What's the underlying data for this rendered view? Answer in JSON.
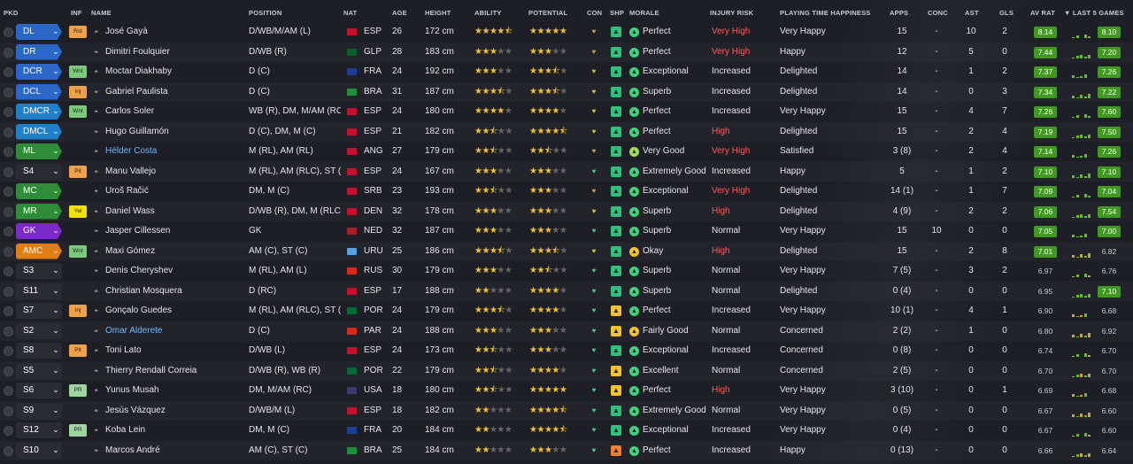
{
  "headers": {
    "pkd": "PKD",
    "inf": "INF",
    "name": "NAME",
    "position": "POSITION",
    "nat": "NAT",
    "age": "AGE",
    "height": "HEIGHT",
    "ability": "ABILITY",
    "potential": "POTENTIAL",
    "con": "CON",
    "shp": "SHP",
    "morale": "MORALE",
    "injury": "INJURY RISK",
    "happiness": "PLAYING TIME HAPPINESS",
    "apps": "APPS",
    "conc": "CONC",
    "ast": "AST",
    "gls": "GLS",
    "avrat": "AV RAT",
    "last5": "▼ LAST 5 GAMES"
  },
  "colors": {
    "gk": "#7b2ac7",
    "def": "#2b67c9",
    "dm": "#1f7fc9",
    "mid": "#2f8d3a",
    "att": "#e07e15",
    "inj_high": "#ff5a5a",
    "rating_green": "#3f9a1f"
  },
  "players": [
    {
      "pos": "DL",
      "posColor": "#2b67c9",
      "inf": "Rst",
      "infColor": "#f0a048",
      "name": "José Gayà",
      "position": "D/WB/M/AM (L)",
      "flag": "#c8102e",
      "nat": "ESP",
      "age": "26",
      "height": "172 cm",
      "ability": 4.5,
      "potential": 5,
      "conColor": "#c9a24b",
      "shpColor": "#2fc07a",
      "morale": "Perfect",
      "moraleColor": "#3ed27a",
      "injury": "Very High",
      "injRed": true,
      "happiness": "Very Happy",
      "apps": "15",
      "conc": "-",
      "ast": "10",
      "gls": "2",
      "avr": "8.14",
      "avrColor": "#3f9a1f",
      "l5": "8.10",
      "l5Color": "#3f9a1f"
    },
    {
      "pos": "DR",
      "posColor": "#2b67c9",
      "inf": "",
      "infColor": "",
      "name": "Dimitri Foulquier",
      "position": "D/WB (R)",
      "flag": "#0b5d2a",
      "nat": "GLP",
      "age": "28",
      "height": "183 cm",
      "ability": 3,
      "potential": 3,
      "conColor": "#c9a24b",
      "shpColor": "#2fc07a",
      "morale": "Perfect",
      "moraleColor": "#3ed27a",
      "injury": "Very High",
      "injRed": true,
      "happiness": "Happy",
      "apps": "12",
      "conc": "-",
      "ast": "5",
      "gls": "0",
      "avr": "7.44",
      "avrColor": "#3f9a1f",
      "l5": "7.20",
      "l5Color": "#3f9a1f"
    },
    {
      "pos": "DCR",
      "posColor": "#2b67c9",
      "inf": "Wnt",
      "infColor": "#7ec87e",
      "name": "Moctar Diakhaby",
      "position": "D (C)",
      "flag": "#1c3f94",
      "nat": "FRA",
      "age": "24",
      "height": "192 cm",
      "ability": 3,
      "potential": 3.5,
      "conColor": "#d7c03a",
      "shpColor": "#2fc07a",
      "morale": "Exceptional",
      "moraleColor": "#3ed27a",
      "injury": "Increased",
      "injRed": false,
      "happiness": "Delighted",
      "apps": "14",
      "conc": "-",
      "ast": "1",
      "gls": "2",
      "avr": "7.37",
      "avrColor": "#3f9a1f",
      "l5": "7.26",
      "l5Color": "#3f9a1f"
    },
    {
      "pos": "DCL",
      "posColor": "#2b67c9",
      "inf": "Inj",
      "infColor": "#f0a048",
      "name": "Gabriel Paulista",
      "position": "D (C)",
      "flag": "#1f8f3a",
      "nat": "BRA",
      "age": "31",
      "height": "187 cm",
      "ability": 3.5,
      "potential": 3.5,
      "conColor": "#d7c03a",
      "shpColor": "#2fc07a",
      "morale": "Superb",
      "moraleColor": "#3ed27a",
      "injury": "Increased",
      "injRed": false,
      "happiness": "Delighted",
      "apps": "14",
      "conc": "-",
      "ast": "0",
      "gls": "3",
      "avr": "7.34",
      "avrColor": "#3f9a1f",
      "l5": "7.22",
      "l5Color": "#3f9a1f"
    },
    {
      "pos": "DMCR",
      "posColor": "#1f7fc9",
      "inf": "Wnt",
      "infColor": "#7ec87e",
      "name": "Carlos Soler",
      "position": "WB (R), DM, M/AM (RC)",
      "flag": "#c8102e",
      "nat": "ESP",
      "age": "24",
      "height": "180 cm",
      "ability": 4,
      "potential": 4,
      "conColor": "#d7c03a",
      "shpColor": "#2fc07a",
      "morale": "Perfect",
      "moraleColor": "#3ed27a",
      "injury": "Increased",
      "injRed": false,
      "happiness": "Very Happy",
      "apps": "15",
      "conc": "-",
      "ast": "4",
      "gls": "7",
      "avr": "7.26",
      "avrColor": "#3f9a1f",
      "l5": "7.60",
      "l5Color": "#3f9a1f"
    },
    {
      "pos": "DMCL",
      "posColor": "#1f7fc9",
      "inf": "",
      "infColor": "",
      "name": "Hugo Guillamón",
      "position": "D (C), DM, M (C)",
      "flag": "#c8102e",
      "nat": "ESP",
      "age": "21",
      "height": "182 cm",
      "ability": 2.5,
      "potential": 4.5,
      "conColor": "#d7c03a",
      "shpColor": "#2fc07a",
      "morale": "Perfect",
      "moraleColor": "#3ed27a",
      "injury": "High",
      "injRed": true,
      "happiness": "Delighted",
      "apps": "15",
      "conc": "-",
      "ast": "2",
      "gls": "4",
      "avr": "7.19",
      "avrColor": "#3f9a1f",
      "l5": "7.50",
      "l5Color": "#3f9a1f"
    },
    {
      "pos": "ML",
      "posColor": "#2f8d3a",
      "inf": "",
      "infColor": "",
      "name": "Hélder Costa",
      "nameLink": true,
      "position": "M (RL), AM (RL)",
      "flag": "#c8102e",
      "nat": "ANG",
      "age": "27",
      "height": "179 cm",
      "ability": 2.5,
      "potential": 2.5,
      "conColor": "#c9a24b",
      "shpColor": "#2fc07a",
      "morale": "Very Good",
      "moraleColor": "#9fe04a",
      "injury": "Very High",
      "injRed": true,
      "happiness": "Satisfied",
      "apps": "3 (8)",
      "conc": "-",
      "ast": "2",
      "gls": "4",
      "avr": "7.14",
      "avrColor": "#3f9a1f",
      "l5": "7.26",
      "l5Color": "#3f9a1f"
    },
    {
      "pos": "S4",
      "posColor": "",
      "inf": "Pit",
      "infColor": "#f0a048",
      "name": "Manu Vallejo",
      "position": "M (RL), AM (RLC), ST (C)",
      "flag": "#c8102e",
      "nat": "ESP",
      "age": "24",
      "height": "167 cm",
      "ability": 3,
      "potential": 3,
      "conColor": "#3ed27a",
      "shpColor": "#2fc07a",
      "morale": "Extremely Good",
      "moraleColor": "#3ed27a",
      "injury": "Increased",
      "injRed": false,
      "happiness": "Happy",
      "apps": "5",
      "conc": "-",
      "ast": "1",
      "gls": "2",
      "avr": "7.10",
      "avrColor": "#3f9a1f",
      "l5": "7.10",
      "l5Color": "#3f9a1f"
    },
    {
      "pos": "MC",
      "posColor": "#2f8d3a",
      "inf": "",
      "infColor": "",
      "name": "Uroš Račić",
      "position": "DM, M (C)",
      "flag": "#c8102e",
      "nat": "SRB",
      "age": "23",
      "height": "193 cm",
      "ability": 2.5,
      "potential": 3,
      "conColor": "#c9a24b",
      "shpColor": "#2fc07a",
      "morale": "Exceptional",
      "moraleColor": "#3ed27a",
      "injury": "Very High",
      "injRed": true,
      "happiness": "Delighted",
      "apps": "14 (1)",
      "conc": "-",
      "ast": "1",
      "gls": "7",
      "avr": "7.09",
      "avrColor": "#3f9a1f",
      "l5": "7.04",
      "l5Color": "#3f9a1f"
    },
    {
      "pos": "MR",
      "posColor": "#2f8d3a",
      "inf": "Yel",
      "infColor": "#f2e20a",
      "name": "Daniel Wass",
      "position": "D/WB (R), DM, M (RLC)",
      "flag": "#c8102e",
      "nat": "DEN",
      "age": "32",
      "height": "178 cm",
      "ability": 3,
      "potential": 3,
      "conColor": "#d7c03a",
      "shpColor": "#2fc07a",
      "morale": "Superb",
      "moraleColor": "#3ed27a",
      "injury": "High",
      "injRed": true,
      "happiness": "Delighted",
      "apps": "4 (9)",
      "conc": "-",
      "ast": "2",
      "gls": "2",
      "avr": "7.06",
      "avrColor": "#3f9a1f",
      "l5": "7.54",
      "l5Color": "#3f9a1f"
    },
    {
      "pos": "GK",
      "posColor": "#7b2ac7",
      "inf": "",
      "infColor": "",
      "name": "Jasper Cillessen",
      "position": "GK",
      "flag": "#ae1c28",
      "nat": "NED",
      "age": "32",
      "height": "187 cm",
      "ability": 3,
      "potential": 3,
      "conColor": "#3ed27a",
      "shpColor": "#2fc07a",
      "morale": "Superb",
      "moraleColor": "#3ed27a",
      "injury": "Normal",
      "injRed": false,
      "happiness": "Very Happy",
      "apps": "15",
      "conc": "10",
      "ast": "0",
      "gls": "0",
      "avr": "7.05",
      "avrColor": "#3f9a1f",
      "l5": "7.00",
      "l5Color": "#3f9a1f"
    },
    {
      "pos": "AMC",
      "posColor": "#e07e15",
      "inf": "Wnt",
      "infColor": "#7ec87e",
      "name": "Maxi Gómez",
      "position": "AM (C), ST (C)",
      "flag": "#5aa0de",
      "nat": "URU",
      "age": "25",
      "height": "186 cm",
      "ability": 3.5,
      "potential": 3.5,
      "conColor": "#d7c03a",
      "shpColor": "#2fc07a",
      "morale": "Okay",
      "moraleColor": "#f2c230",
      "injury": "High",
      "injRed": true,
      "happiness": "Delighted",
      "apps": "15",
      "conc": "-",
      "ast": "2",
      "gls": "8",
      "avr": "7.01",
      "avrColor": "#3f9a1f",
      "l5": "6.82",
      "l5Color": ""
    },
    {
      "pos": "S3",
      "posColor": "",
      "inf": "",
      "infColor": "",
      "name": "Denis Cheryshev",
      "position": "M (RL), AM (L)",
      "flag": "#d52b1e",
      "nat": "RUS",
      "age": "30",
      "height": "179 cm",
      "ability": 3,
      "potential": 2.5,
      "conColor": "#3ed27a",
      "shpColor": "#2fc07a",
      "morale": "Superb",
      "moraleColor": "#3ed27a",
      "injury": "Normal",
      "injRed": false,
      "happiness": "Very Happy",
      "apps": "7 (5)",
      "conc": "-",
      "ast": "3",
      "gls": "2",
      "avr": "6.97",
      "avrColor": "",
      "l5": "6.76",
      "l5Color": ""
    },
    {
      "pos": "S11",
      "posColor": "",
      "inf": "",
      "infColor": "",
      "name": "Christian Mosquera",
      "position": "D (RC)",
      "flag": "#c8102e",
      "nat": "ESP",
      "age": "17",
      "height": "188 cm",
      "ability": 2,
      "potential": 4,
      "conColor": "#3ed27a",
      "shpColor": "#2fc07a",
      "morale": "Superb",
      "moraleColor": "#3ed27a",
      "injury": "Normal",
      "injRed": false,
      "happiness": "Delighted",
      "apps": "0 (4)",
      "conc": "-",
      "ast": "0",
      "gls": "0",
      "avr": "6.95",
      "avrColor": "",
      "l5": "7.10",
      "l5Color": "#3f9a1f"
    },
    {
      "pos": "S7",
      "posColor": "",
      "inf": "Inj",
      "infColor": "#f0a048",
      "name": "Gonçalo Guedes",
      "position": "M (RL), AM (RLC), ST (C)",
      "flag": "#046a38",
      "nat": "POR",
      "age": "24",
      "height": "179 cm",
      "ability": 3.5,
      "potential": 4,
      "conColor": "#3ed27a",
      "shpColor": "#f2c230",
      "morale": "Perfect",
      "moraleColor": "#3ed27a",
      "injury": "Increased",
      "injRed": false,
      "happiness": "Very Happy",
      "apps": "10 (1)",
      "conc": "-",
      "ast": "4",
      "gls": "1",
      "avr": "6.90",
      "avrColor": "",
      "l5": "6.68",
      "l5Color": ""
    },
    {
      "pos": "S2",
      "posColor": "",
      "inf": "",
      "infColor": "",
      "name": "Omar Alderete",
      "nameLink": true,
      "position": "D (C)",
      "flag": "#d52b1e",
      "nat": "PAR",
      "age": "24",
      "height": "188 cm",
      "ability": 3,
      "potential": 3,
      "conColor": "#3ed27a",
      "shpColor": "#f2c230",
      "morale": "Fairly Good",
      "moraleColor": "#f2c230",
      "injury": "Normal",
      "injRed": false,
      "happiness": "Concerned",
      "apps": "2 (2)",
      "conc": "-",
      "ast": "1",
      "gls": "0",
      "avr": "6.80",
      "avrColor": "",
      "l5": "6.92",
      "l5Color": ""
    },
    {
      "pos": "S8",
      "posColor": "",
      "inf": "Pit",
      "infColor": "#f0a048",
      "name": "Toni Lato",
      "position": "D/WB (L)",
      "flag": "#c8102e",
      "nat": "ESP",
      "age": "24",
      "height": "173 cm",
      "ability": 2.5,
      "potential": 3,
      "conColor": "#3ed27a",
      "shpColor": "#2fc07a",
      "morale": "Exceptional",
      "moraleColor": "#3ed27a",
      "injury": "Increased",
      "injRed": false,
      "happiness": "Concerned",
      "apps": "0 (8)",
      "conc": "-",
      "ast": "0",
      "gls": "0",
      "avr": "6.74",
      "avrColor": "",
      "l5": "6.70",
      "l5Color": ""
    },
    {
      "pos": "S5",
      "posColor": "",
      "inf": "",
      "infColor": "",
      "name": "Thierry Rendall Correia",
      "position": "D/WB (R), WB (R)",
      "flag": "#046a38",
      "nat": "POR",
      "age": "22",
      "height": "179 cm",
      "ability": 2.5,
      "potential": 4,
      "conColor": "#3ed27a",
      "shpColor": "#f2c230",
      "morale": "Excellent",
      "moraleColor": "#3ed27a",
      "injury": "Normal",
      "injRed": false,
      "happiness": "Concerned",
      "apps": "2 (5)",
      "conc": "-",
      "ast": "0",
      "gls": "0",
      "avr": "6.70",
      "avrColor": "",
      "l5": "6.70",
      "l5Color": ""
    },
    {
      "pos": "S6",
      "posColor": "",
      "inf": "PR",
      "infColor": "#9ed49e",
      "name": "Yunus Musah",
      "position": "DM, M/AM (RC)",
      "flag": "#3c3b6e",
      "nat": "USA",
      "age": "18",
      "height": "180 cm",
      "ability": 2.5,
      "potential": 5,
      "conColor": "#3ed27a",
      "shpColor": "#f2c230",
      "morale": "Perfect",
      "moraleColor": "#3ed27a",
      "injury": "High",
      "injRed": true,
      "happiness": "Very Happy",
      "apps": "3 (10)",
      "conc": "-",
      "ast": "0",
      "gls": "1",
      "avr": "6.69",
      "avrColor": "",
      "l5": "6.68",
      "l5Color": ""
    },
    {
      "pos": "S9",
      "posColor": "",
      "inf": "",
      "infColor": "",
      "name": "Jesús Vázquez",
      "position": "D/WB/M (L)",
      "flag": "#c8102e",
      "nat": "ESP",
      "age": "18",
      "height": "182 cm",
      "ability": 2,
      "potential": 4.5,
      "conColor": "#3ed27a",
      "shpColor": "#2fc07a",
      "morale": "Extremely Good",
      "moraleColor": "#3ed27a",
      "injury": "Normal",
      "injRed": false,
      "happiness": "Very Happy",
      "apps": "0 (5)",
      "conc": "-",
      "ast": "0",
      "gls": "0",
      "avr": "6.67",
      "avrColor": "",
      "l5": "6.60",
      "l5Color": ""
    },
    {
      "pos": "S12",
      "posColor": "",
      "inf": "PR",
      "infColor": "#9ed49e",
      "name": "Koba Lein",
      "position": "DM, M (C)",
      "flag": "#1c3f94",
      "nat": "FRA",
      "age": "20",
      "height": "184 cm",
      "ability": 2,
      "potential": 4.5,
      "conColor": "#3ed27a",
      "shpColor": "#2fc07a",
      "morale": "Exceptional",
      "moraleColor": "#3ed27a",
      "injury": "Increased",
      "injRed": false,
      "happiness": "Very Happy",
      "apps": "0 (4)",
      "conc": "-",
      "ast": "0",
      "gls": "0",
      "avr": "6.67",
      "avrColor": "",
      "l5": "6.60",
      "l5Color": ""
    },
    {
      "pos": "S10",
      "posColor": "",
      "inf": "",
      "infColor": "",
      "name": "Marcos André",
      "position": "AM (C), ST (C)",
      "flag": "#1f8f3a",
      "nat": "BRA",
      "age": "25",
      "height": "184 cm",
      "ability": 2,
      "potential": 3,
      "conColor": "#3ed27a",
      "shpColor": "#f27e30",
      "morale": "Perfect",
      "moraleColor": "#3ed27a",
      "injury": "Increased",
      "injRed": false,
      "happiness": "Happy",
      "apps": "0 (13)",
      "conc": "-",
      "ast": "0",
      "gls": "0",
      "avr": "6.66",
      "avrColor": "",
      "l5": "6.64",
      "l5Color": ""
    }
  ]
}
